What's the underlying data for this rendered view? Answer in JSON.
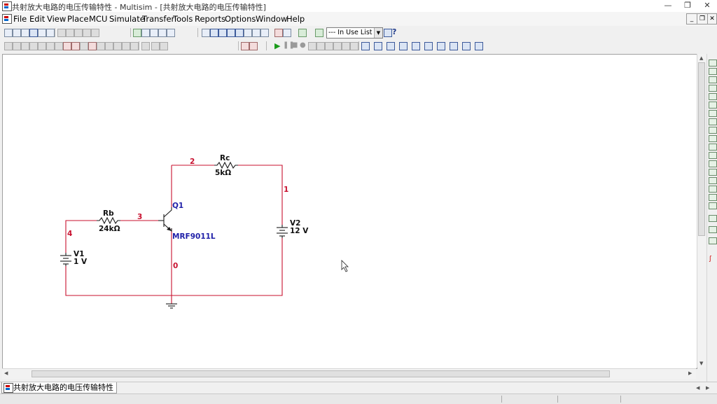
{
  "window": {
    "title": "共射放大电路的电压传输特性 - Multisim - [共射放大电路的电压传输特性]",
    "min_label": "—",
    "max_label": "❐",
    "close_label": "✕"
  },
  "menu": [
    "File",
    "Edit",
    "View",
    "Place",
    "MCU",
    "Simulate",
    "Transfer",
    "Tools",
    "Reports",
    "Options",
    "Window",
    "Help"
  ],
  "toolbar": {
    "in_use_list_label": "--- In Use List ---",
    "help_label": "?"
  },
  "schematic": {
    "components": {
      "rb": {
        "name": "Rb",
        "value": "24kΩ"
      },
      "rc": {
        "name": "Rc",
        "value": "5kΩ"
      },
      "q1": {
        "name": "Q1",
        "model": "MRF9011L"
      },
      "v1": {
        "name": "V1",
        "value": "1 V"
      },
      "v2": {
        "name": "V2",
        "value": "12 V"
      }
    },
    "nets": {
      "n0": "0",
      "n1": "1",
      "n2": "2",
      "n3": "3",
      "n4": "4"
    },
    "colors": {
      "wire": "#c8102e",
      "part_label": "#1f1fa8",
      "component": "#1a1a1a"
    }
  },
  "tabs": [
    {
      "label": "共射放大电路的电压传输特性"
    }
  ],
  "icons": {
    "app": "multisim-app-icon",
    "cursor": "mouse-pointer-icon"
  }
}
